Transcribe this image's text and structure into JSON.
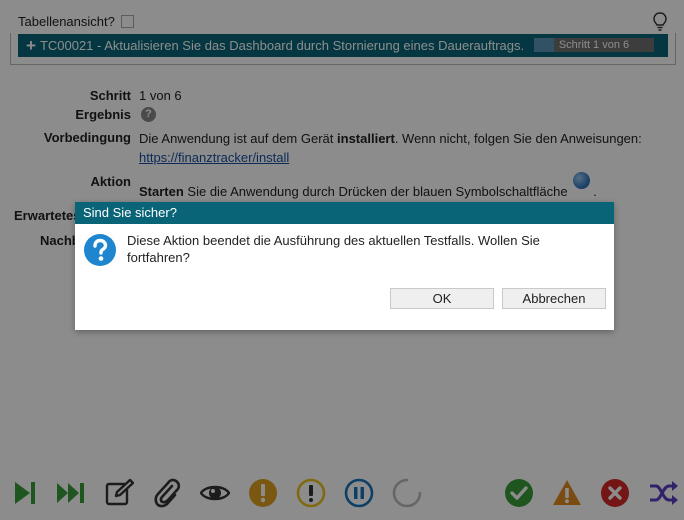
{
  "table_view": {
    "label": "Tabellenansicht?"
  },
  "testcase": {
    "title": "TC00021 - Aktualisieren Sie das Dashboard durch Stornierung eines Dauerauftrags.",
    "step_progress": "Schritt 1 von 6",
    "progress_fraction": 0.1667
  },
  "fields": {
    "schritt_label": "Schritt",
    "schritt_value": "1 von 6",
    "ergebnis_label": "Ergebnis",
    "vorbedingung_label": "Vorbedingung",
    "vorbedingung_text": "Die Anwendung ist auf dem Gerät",
    "vorbedingung_bold": "installiert",
    "vorbedingung_text2": ". Wenn nicht, folgen Sie den Anweisungen:",
    "vorbedingung_link": "https://finanztracker/install",
    "aktion_label": "Aktion",
    "aktion_bold": "Starten",
    "aktion_text": "Sie die Anwendung durch Drücken der blauen Symbolschaltfläche",
    "aktion_end": ".",
    "erwartetes_label": "Erwartetes",
    "nachb_label": "Nachb"
  },
  "dialog": {
    "title": "Sind Sie sicher?",
    "message": "Diese Aktion beendet die Ausführung des aktuellen Testfalls. Wollen Sie fortfahren?",
    "ok_label": "OK",
    "cancel_label": "Abbrechen"
  },
  "toolbar": {
    "icons": [
      "step-forward-icon",
      "fast-forward-icon",
      "edit-icon",
      "paperclip-icon",
      "eye-icon",
      "warning-orange-icon",
      "warning-yellow-icon",
      "pause-icon",
      "spinner-icon",
      "check-icon",
      "alert-triangle-icon",
      "error-icon",
      "shuffle-icon"
    ]
  },
  "colors": {
    "header_teal": "#0a6478",
    "green": "#3a9d3a",
    "orange": "#e0a020",
    "yellow": "#e8c020",
    "blue": "#1a73b8",
    "red": "#d62828",
    "purple": "#5b3fc4"
  }
}
